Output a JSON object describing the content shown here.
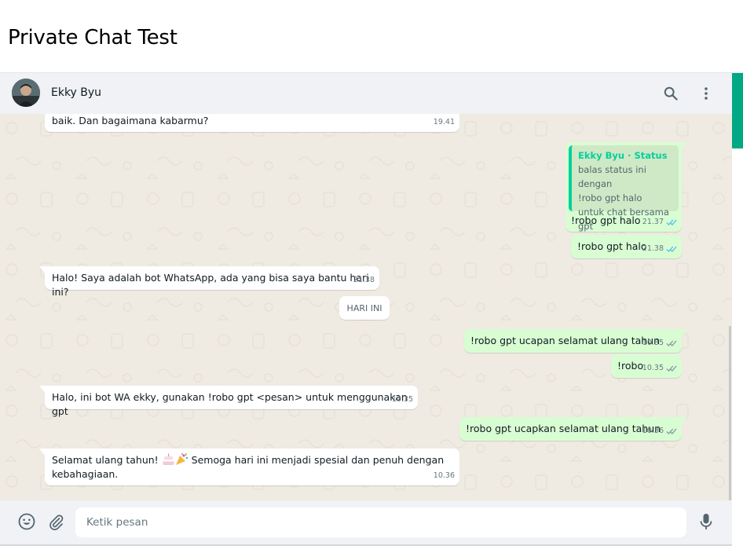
{
  "page": {
    "title": "Private Chat Test"
  },
  "header": {
    "contact_name": "Ekky Byu",
    "icons": [
      "search-icon",
      "menu-dots-icon"
    ]
  },
  "messages": [
    {
      "dir": "in",
      "text": "baik. Dan bagaimana kabarmu?",
      "time": "19.41"
    },
    {
      "dir": "out",
      "quote_author": "Ekky Byu · Status",
      "quote_text": "balas status ini dengan\n!robo gpt halo\nuntuk chat bersama gpt",
      "text": "!robo gpt halo",
      "time": "21.37",
      "status": "read"
    },
    {
      "dir": "out",
      "text": "!robo gpt halo",
      "time": "21.38",
      "status": "read"
    },
    {
      "dir": "in",
      "text": "Halo! Saya adalah bot WhatsApp, ada yang bisa saya bantu hari ini?",
      "time": "21.38"
    },
    {
      "dir": "out",
      "text": "!robo gpt ucapan selamat ulang tahun",
      "time": "10.35",
      "status": "delivered"
    },
    {
      "dir": "out",
      "text": "!robo",
      "time": "10.35",
      "status": "delivered"
    },
    {
      "dir": "in",
      "text": "Halo, ini bot WA ekky, gunakan !robo gpt <pesan> untuk menggunakan gpt",
      "time": "10.35"
    },
    {
      "dir": "out",
      "text": "!robo gpt ucapkan selamat ulang tahun",
      "time": "10.36",
      "status": "delivered"
    },
    {
      "dir": "in",
      "text_before": "Selamat ulang tahun! ",
      "emojis": [
        "cake-emoji",
        "party-popper-emoji"
      ],
      "text_after": " Semoga hari ini menjadi spesial dan penuh dengan",
      "text_line2": "kebahagiaan.",
      "time": "10.36"
    }
  ],
  "date_chip": "HARI INI",
  "footer": {
    "placeholder": "Ketik pesan",
    "icons": [
      "emoji-icon",
      "attach-icon",
      "mic-icon"
    ]
  },
  "colors": {
    "accent": "#00a884",
    "chat_bg": "#efeae2",
    "out_bubble": "#d9fdd3",
    "in_bubble": "#ffffff",
    "header_bg": "#f0f2f5",
    "read_tick": "#53bdeb",
    "quote_author": "#06cf9c"
  }
}
